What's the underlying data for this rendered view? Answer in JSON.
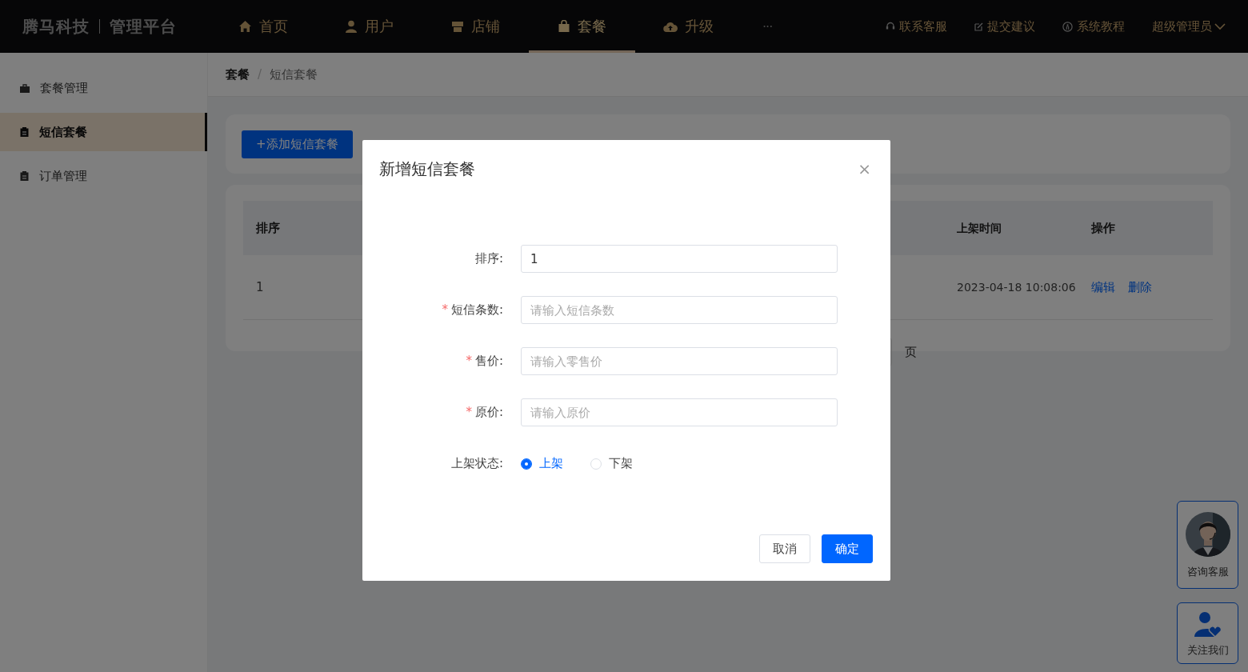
{
  "header": {
    "brand": "腾马科技",
    "subtitle": "管理平台",
    "nav": [
      {
        "label": "首页",
        "selected": false
      },
      {
        "label": "用户",
        "selected": false
      },
      {
        "label": "店铺",
        "selected": false
      },
      {
        "label": "套餐",
        "selected": true
      },
      {
        "label": "升级",
        "selected": false
      }
    ],
    "more": "···",
    "links": [
      {
        "label": "联系客服"
      },
      {
        "label": "提交建议"
      },
      {
        "label": "系统教程"
      }
    ],
    "user": "超级管理员"
  },
  "sidebar": {
    "items": [
      {
        "label": "套餐管理",
        "selected": false
      },
      {
        "label": "短信套餐",
        "selected": true
      },
      {
        "label": "订单管理",
        "selected": false
      }
    ]
  },
  "breadcrumb": [
    "套餐",
    "短信套餐"
  ],
  "breadcrumb_separator": "/",
  "add_button": "+添加短信套餐",
  "table": {
    "columns": [
      "排序",
      "上架时间",
      "操作"
    ],
    "rows": [
      {
        "cells": [
          "1",
          "2023-04-18 10:08:06"
        ],
        "actions": [
          "编辑",
          "删除"
        ]
      }
    ]
  },
  "pagination": {
    "suffix": "页"
  },
  "dialog": {
    "title": "新增短信套餐",
    "close": "×",
    "required_mark": "*",
    "fields": [
      {
        "kind": "input",
        "label": "排序:",
        "required": false,
        "value": "1"
      },
      {
        "kind": "input",
        "label": "短信条数:",
        "required": true,
        "placeholder": "请输入短信条数"
      },
      {
        "kind": "input",
        "label": "售价:",
        "required": true,
        "placeholder": "请输入零售价"
      },
      {
        "kind": "input",
        "label": "原价:",
        "required": true,
        "placeholder": "请输入原价"
      },
      {
        "kind": "radio",
        "label": "上架状态:",
        "options": [
          {
            "label": "上架",
            "selected": true
          },
          {
            "label": "下架",
            "selected": false
          }
        ]
      }
    ],
    "buttons": [
      {
        "label": "取消",
        "kind": "default"
      },
      {
        "label": "确定",
        "kind": "primary"
      }
    ]
  },
  "float_widgets": [
    {
      "kind": "avatar",
      "label": "咨询客服"
    },
    {
      "kind": "icon",
      "label": "关注我们"
    }
  ]
}
